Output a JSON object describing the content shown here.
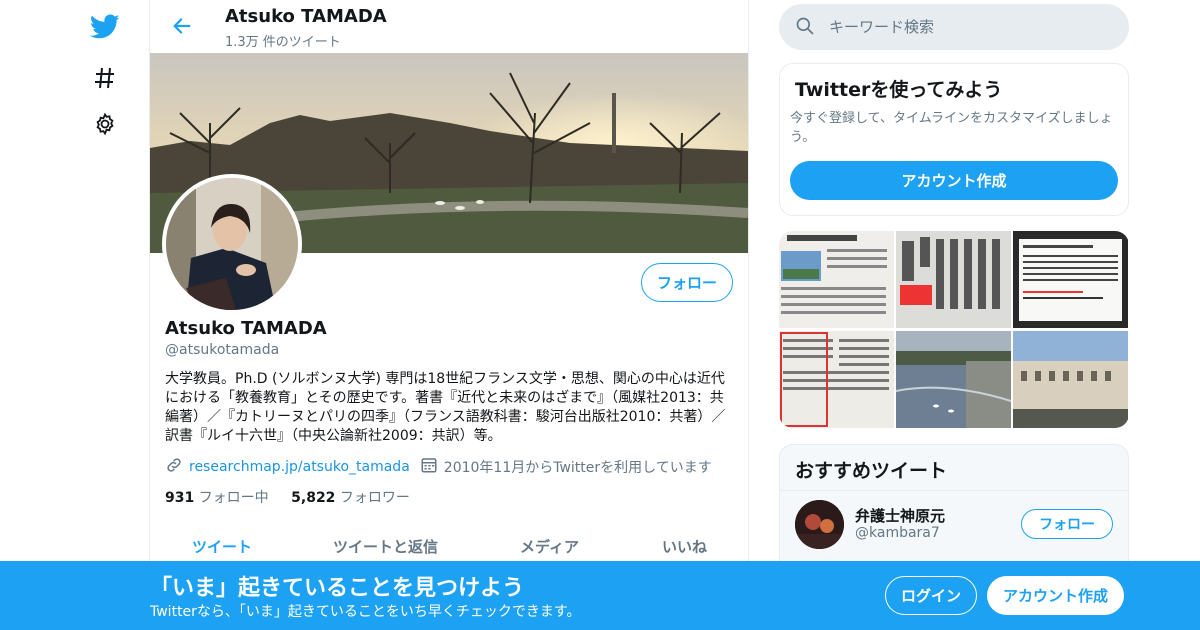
{
  "header": {
    "name": "Atsuko TAMADA",
    "tweet_count": "1.3万 件のツイート"
  },
  "profile": {
    "name": "Atsuko TAMADA",
    "handle": "@atsukotamada",
    "bio": "大学教員。Ph.D (ソルボンヌ大学) 専門は18世紀フランス文学・思想、関心の中心は近代における「教養教育」とその歴史です。著書『近代と未来のはざまで』（風媒社2013：共編著）／『カトリーヌとパリの四季』（フランス語教科書：駿河台出版社2010：共著）／訳書『ルイ十六世』（中央公論新社2009：共訳）等。",
    "website": "researchmap.jp/atsuko_tamada",
    "joined": "2010年11月からTwitterを利用しています",
    "following_count": "931",
    "following_label": "フォロー中",
    "followers_count": "5,822",
    "followers_label": "フォロワー",
    "follow_label": "フォロー"
  },
  "tabs": [
    "ツイート",
    "ツイートと返信",
    "メディア",
    "いいね"
  ],
  "search": {
    "placeholder": "キーワード検索"
  },
  "signup_card": {
    "title": "Twitterを使ってみよう",
    "description": "今すぐ登録して、タイムラインをカスタマイズしましょう。",
    "button": "アカウント作成"
  },
  "recommend": {
    "title": "おすすめツイート",
    "user_name": "弁護士神原元",
    "user_handle": "@kambara7",
    "follow_label": "フォロー"
  },
  "bottom_bar": {
    "title": "「いま」起きていることを見つけよう",
    "subtitle": "Twitterなら、「いま」起きていることをいち早くチェックできます。",
    "login": "ログイン",
    "signup": "アカウント作成"
  },
  "colors": {
    "accent": "#1da1f2",
    "muted": "#657786",
    "border": "#e6ecf0"
  },
  "icons": {
    "nav": [
      "twitter-bird-icon",
      "hashtag-icon",
      "gear-icon"
    ],
    "back": "back-arrow-icon",
    "search": "search-icon",
    "link": "link-icon",
    "calendar": "calendar-icon"
  }
}
